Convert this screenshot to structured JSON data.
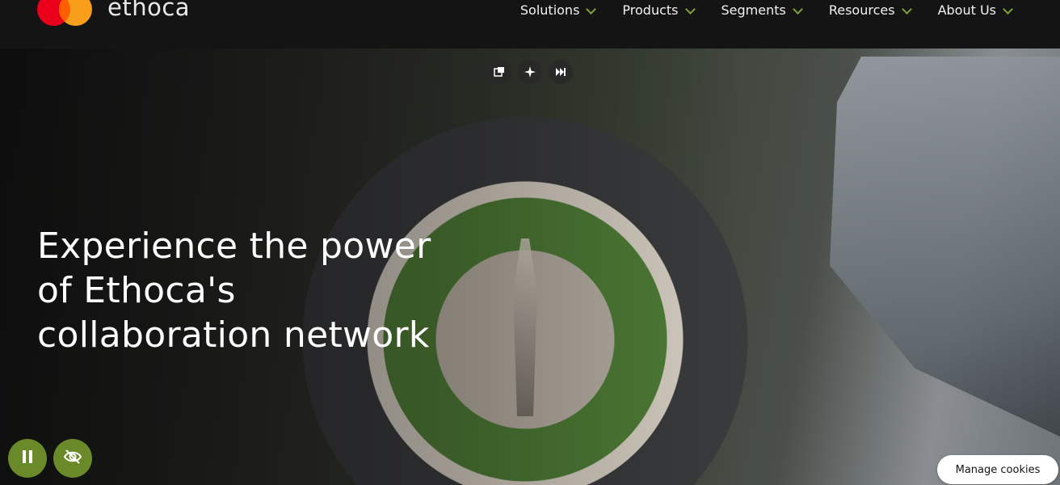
{
  "brand": {
    "name": "ethoca"
  },
  "nav": {
    "items": [
      {
        "label": "Solutions"
      },
      {
        "label": "Products"
      },
      {
        "label": "Segments"
      },
      {
        "label": "Resources"
      },
      {
        "label": "About Us"
      }
    ]
  },
  "hero": {
    "title_line1": "Experience the power",
    "title_line2": "of Ethoca's",
    "title_line3": "collaboration network"
  },
  "controls": {
    "pause_icon": "pause-icon",
    "hide_icon": "eye-slash-icon"
  },
  "cookie": {
    "label": "Manage cookies"
  },
  "colors": {
    "header_bg": "#141414",
    "accent_green": "#6a8a2a",
    "chevron_green": "#7fa33a",
    "mastercard_red": "#eb001b",
    "mastercard_orange": "#f79e1b"
  }
}
